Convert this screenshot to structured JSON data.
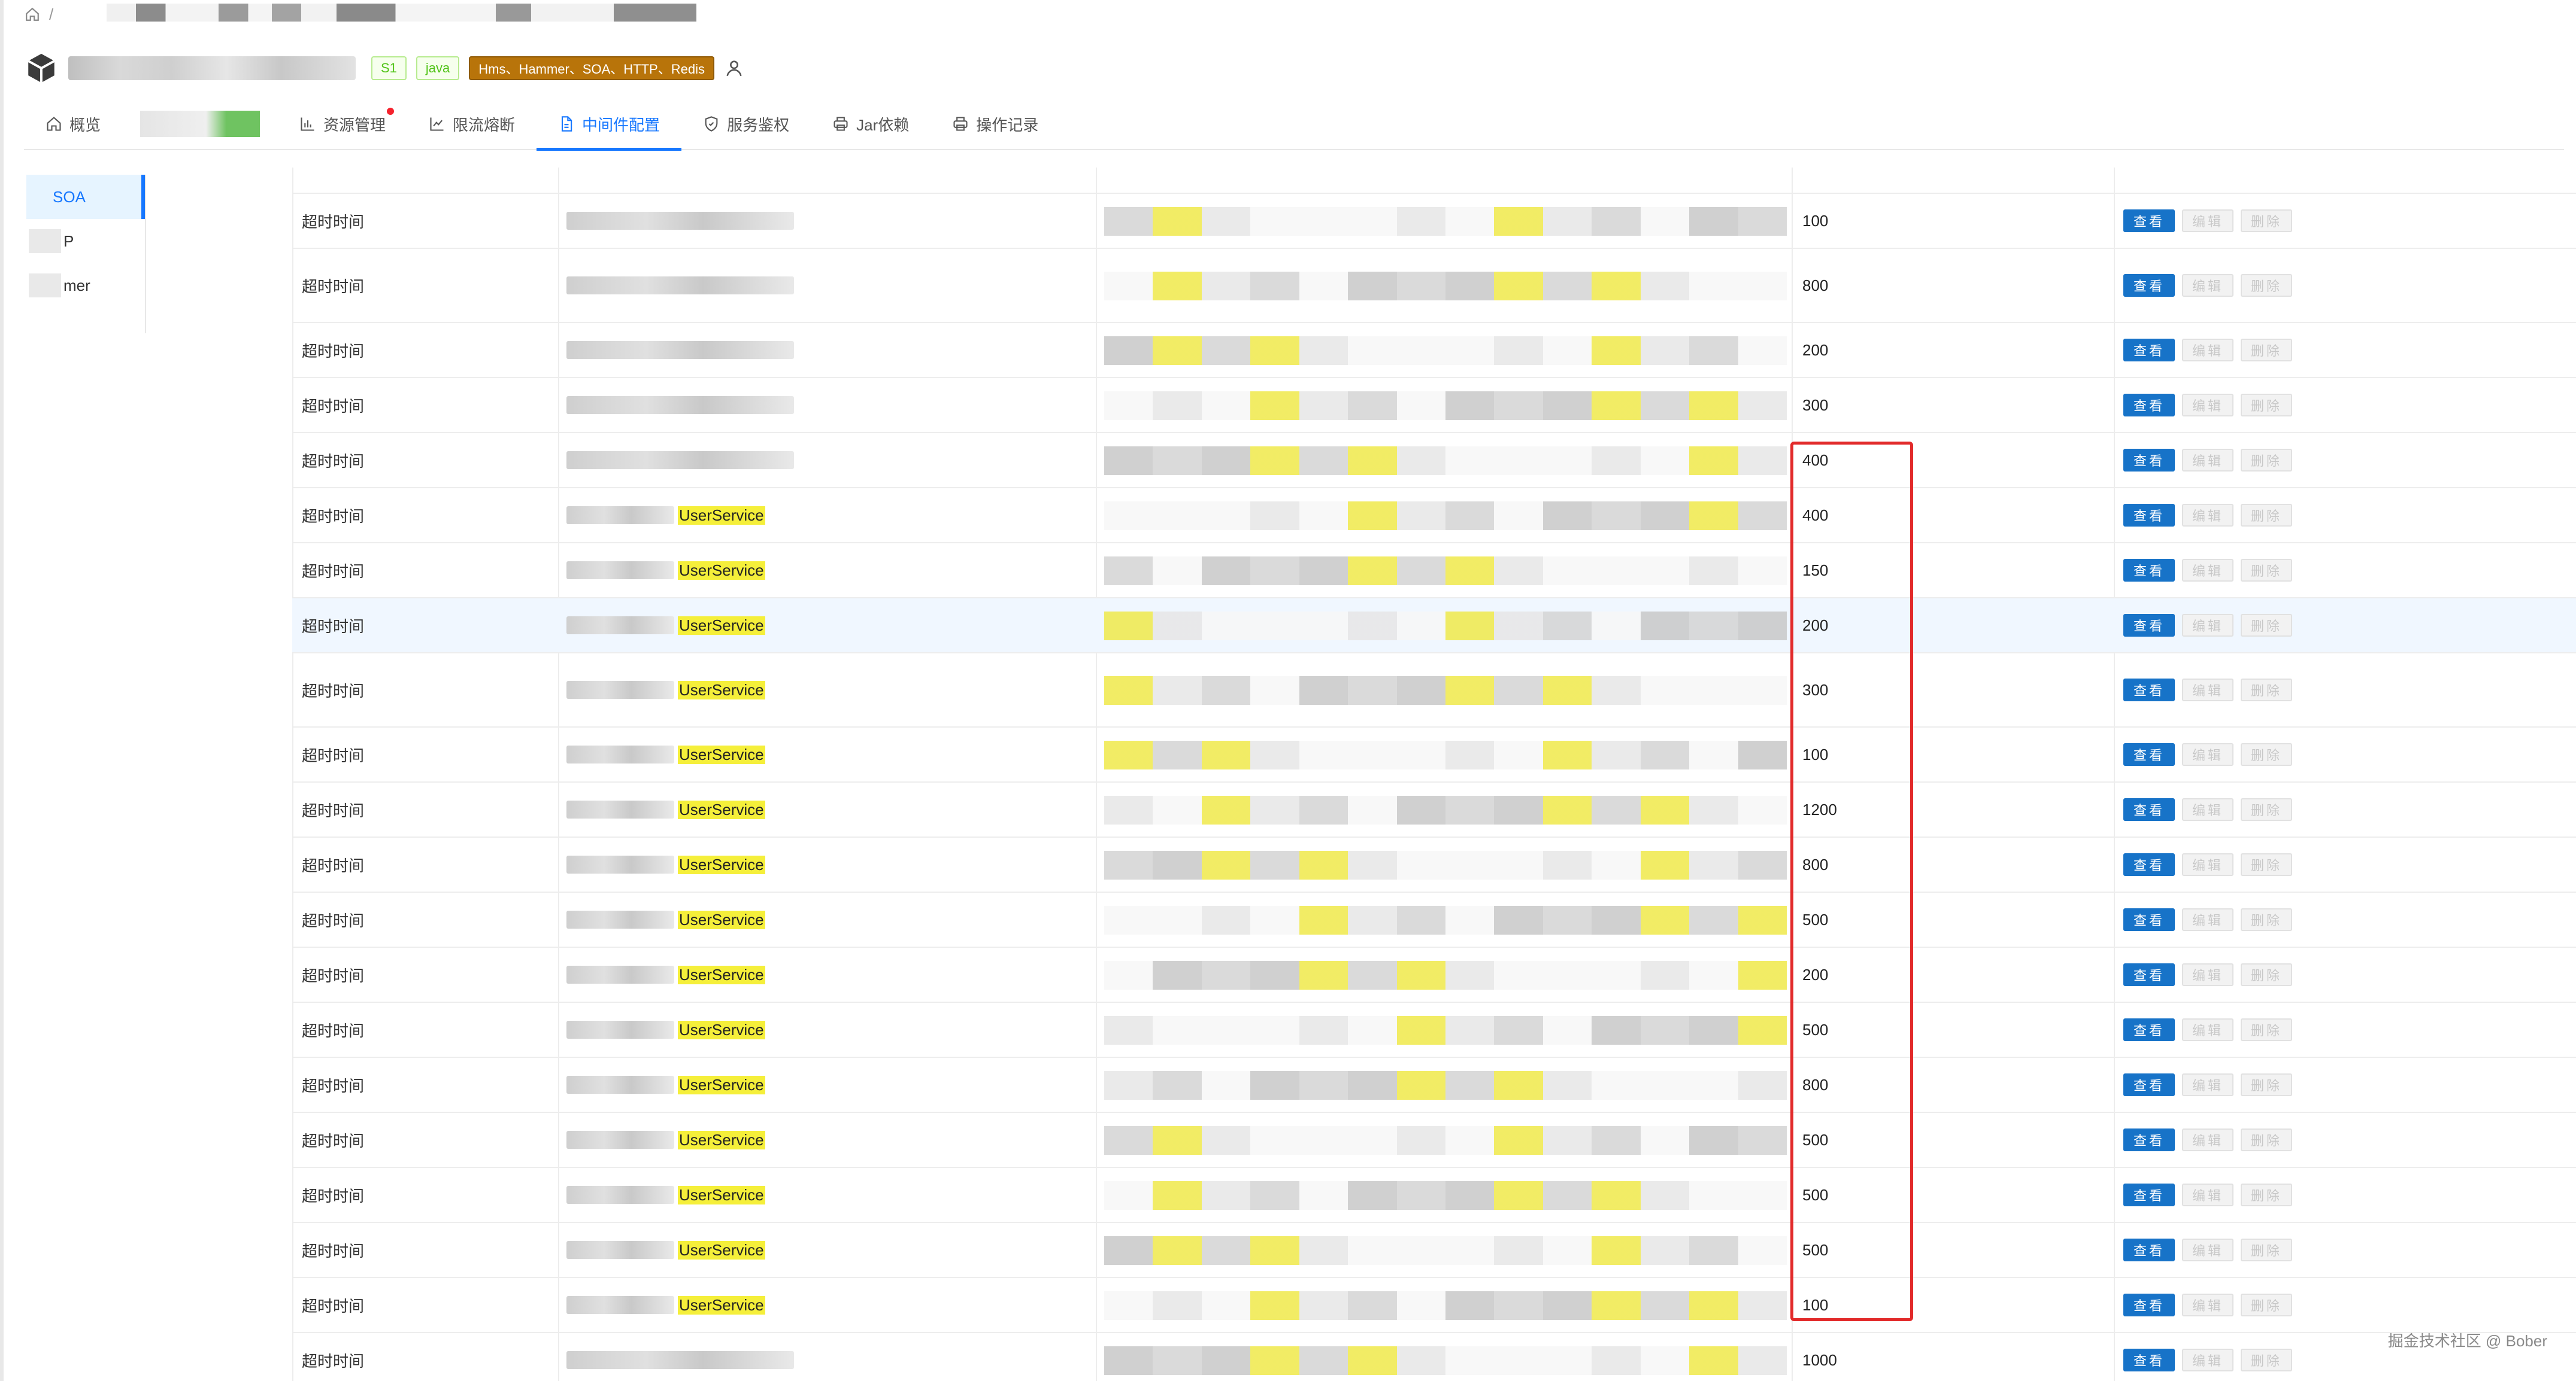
{
  "breadcrumb": {
    "separator": "/"
  },
  "app": {
    "tags": [
      {
        "label": "S1",
        "style": "green"
      },
      {
        "label": "java",
        "style": "green"
      },
      {
        "label": "Hms、Hammer、SOA、HTTP、Redis",
        "style": "orange"
      }
    ]
  },
  "nav": {
    "tabs": [
      {
        "id": "overview",
        "label": "概览",
        "icon": "home-icon"
      },
      {
        "id": "resources",
        "label": "资源管理",
        "icon": "bar-chart-icon",
        "dot": true
      },
      {
        "id": "ratelimit",
        "label": "限流熔断",
        "icon": "line-chart-icon"
      },
      {
        "id": "middleware",
        "label": "中间件配置",
        "icon": "file-icon",
        "active": true
      },
      {
        "id": "auth",
        "label": "服务鉴权",
        "icon": "shield-icon"
      },
      {
        "id": "jar",
        "label": "Jar依赖",
        "icon": "printer-icon"
      },
      {
        "id": "oplog",
        "label": "操作记录",
        "icon": "printer-icon"
      }
    ]
  },
  "side_menu": {
    "items": [
      {
        "label": "SOA",
        "active": true
      },
      {
        "label": "P"
      },
      {
        "label": "mer"
      }
    ]
  },
  "table": {
    "rows": [
      {
        "type": "超时时间",
        "service": "",
        "value": "100"
      },
      {
        "type": "超时时间",
        "service": "",
        "value": "800"
      },
      {
        "type": "超时时间",
        "service": "",
        "value": "200"
      },
      {
        "type": "超时时间",
        "service": "",
        "value": "300"
      },
      {
        "type": "超时时间",
        "service": "",
        "value": "400"
      },
      {
        "type": "超时时间",
        "service": "UserService",
        "value": "400"
      },
      {
        "type": "超时时间",
        "service": "UserService",
        "value": "150"
      },
      {
        "type": "超时时间",
        "service": "UserService",
        "value": "200",
        "highlight": true
      },
      {
        "type": "超时时间",
        "service": "UserService",
        "value": "300"
      },
      {
        "type": "超时时间",
        "service": "UserService",
        "value": "100"
      },
      {
        "type": "超时时间",
        "service": "UserService",
        "value": "1200"
      },
      {
        "type": "超时时间",
        "service": "UserService",
        "value": "800"
      },
      {
        "type": "超时时间",
        "service": "UserService",
        "value": "500"
      },
      {
        "type": "超时时间",
        "service": "UserService",
        "value": "200"
      },
      {
        "type": "超时时间",
        "service": "UserService",
        "value": "500"
      },
      {
        "type": "超时时间",
        "service": "UserService",
        "value": "800"
      },
      {
        "type": "超时时间",
        "service": "UserService",
        "value": "500"
      },
      {
        "type": "超时时间",
        "service": "UserService",
        "value": "500"
      },
      {
        "type": "超时时间",
        "service": "UserService",
        "value": "500"
      },
      {
        "type": "超时时间",
        "service": "UserService",
        "value": "100"
      },
      {
        "type": "超时时间",
        "service": "",
        "value": "1000"
      }
    ],
    "actions": {
      "view": "查看",
      "edit": "编辑",
      "delete": "删除"
    }
  },
  "watermark": "掘金技术社区 @ Bober",
  "colors": {
    "accent": "#1677ff",
    "view_button": "#1773c8",
    "highlight": "#f5ef3a",
    "annotation_box": "#e22a2a"
  }
}
